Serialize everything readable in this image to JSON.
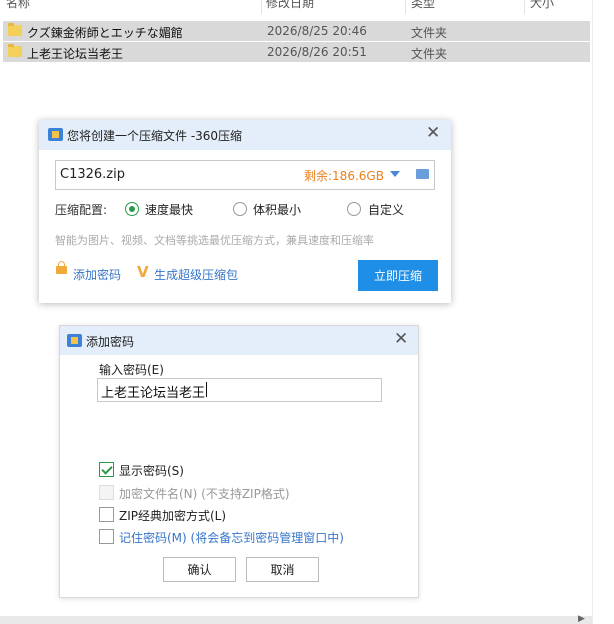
{
  "explorer": {
    "columns": [
      "名称",
      "修改日期",
      "类型",
      "大小"
    ],
    "rows": [
      {
        "name": "クズ錬金術師とエッチな媚館",
        "date": "2026/8/25 20:46",
        "type": "文件夹"
      },
      {
        "name": "上老王论坛当老王",
        "date": "2026/8/26 20:51",
        "type": "文件夹"
      }
    ]
  },
  "compress_dialog": {
    "title": "您将创建一个压缩文件 -360压缩",
    "filename": "C1326.zip",
    "free_space": "剩余:186.6GB",
    "config_label": "压缩配置:",
    "options": [
      "速度最快",
      "体积最小",
      "自定义"
    ],
    "selected_option": "速度最快",
    "hint": "智能为图片、视频、文档等挑选最优压缩方式，兼具速度和压缩率",
    "add_password": "添加密码",
    "super_archive": "生成超级压缩包",
    "compress_now": "立即压缩"
  },
  "password_dialog": {
    "title": "添加密码",
    "input_label": "输入密码(E)",
    "password_value": "上老王论坛当老王",
    "checkboxes": [
      {
        "label": "显示密码(S)",
        "checked": true,
        "disabled": false
      },
      {
        "label": "加密文件名(N) (不支持ZIP格式)",
        "checked": false,
        "disabled": true
      },
      {
        "label": "ZIP经典加密方式(L)",
        "checked": false,
        "disabled": false
      },
      {
        "label": "记住密码(M) (将会备忘到密码管理窗口中)",
        "checked": false,
        "disabled": false
      }
    ],
    "ok": "确认",
    "cancel": "取消"
  },
  "colors": {
    "accent": "#1e8ee6",
    "link": "#3776c9",
    "warning": "#e8801e",
    "check_green": "#2a9a4a",
    "title_bar": "#e3eefa"
  },
  "icons": [
    "folder-icon",
    "app-360-icon",
    "close-icon",
    "dropdown-arrow-icon",
    "browse-folder-icon",
    "lock-icon",
    "v-icon",
    "checkmark-icon"
  ]
}
